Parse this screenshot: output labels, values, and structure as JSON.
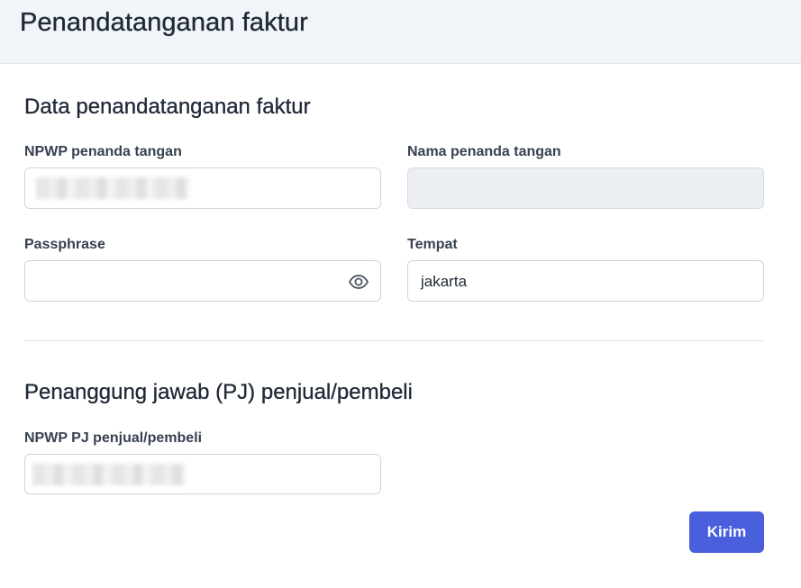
{
  "header": {
    "title": "Penandatanganan faktur"
  },
  "signer_section": {
    "title": "Data penandatanganan faktur",
    "npwp_label": "NPWP penanda tangan",
    "npwp_value": "",
    "name_label": "Nama penanda tangan",
    "name_value": "",
    "passphrase_label": "Passphrase",
    "passphrase_value": "",
    "place_label": "Tempat",
    "place_value": "jakarta"
  },
  "pj_section": {
    "title": "Penanggung jawab (PJ) penjual/pembeli",
    "npwp_label": "NPWP PJ penjual/pembeli",
    "npwp_value": ""
  },
  "actions": {
    "submit_label": "Kirim"
  },
  "colors": {
    "accent": "#4a5fdb",
    "header_bg": "#f1f4f9",
    "disabled_bg": "#eceff2"
  },
  "icons": {
    "show_password": "eye-icon"
  }
}
